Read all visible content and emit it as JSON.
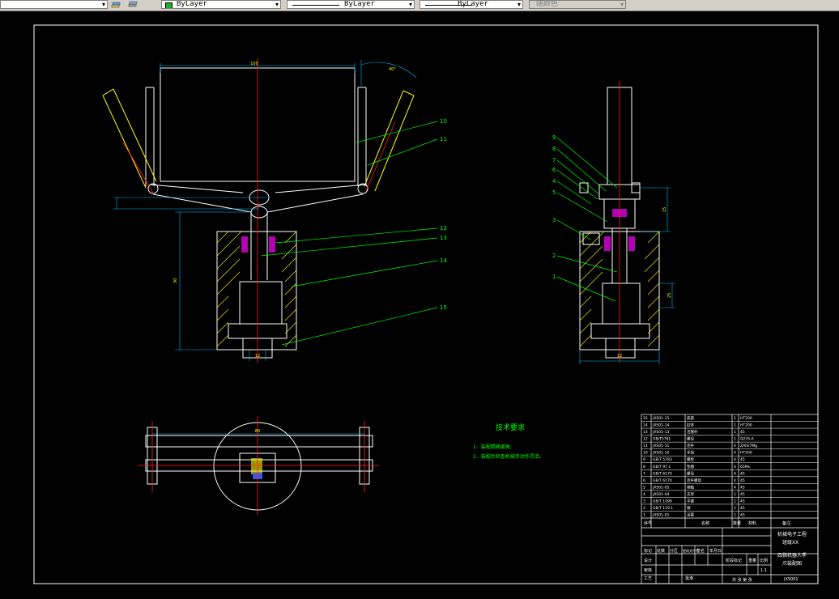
{
  "toolbar": {
    "layer_arrow": "▾",
    "color_value": "ByLayer",
    "linetype_value": "ByLayer",
    "lineweight_value": "ByLayer",
    "plotstyle_value": "随颜色",
    "icons": [
      "layers-icon",
      "layer-states-icon"
    ]
  },
  "drawing": {
    "dim_top_width": "100",
    "dim_angle": "40°",
    "dim_height": "30",
    "dim_bottom": "12",
    "dim_side_vertical": "15",
    "dim_side_lower": "25",
    "dim_side_bottom": "12",
    "dim_plan": "80",
    "part_numbers_left": [
      "10",
      "11",
      "12",
      "13",
      "14",
      "15"
    ],
    "part_numbers_right": [
      "9",
      "8",
      "7",
      "6",
      "5",
      "4",
      "3",
      "2",
      "1"
    ]
  },
  "tech_requirements": {
    "title": "技术要求",
    "item1": "1、装配精确度高;",
    "item2": "2、装配后检查机械手动作灵活。"
  },
  "title_block": {
    "company_line1": "机械电子工程",
    "company_line2": "班级XX",
    "drawing_name_line1": "四指机器人手",
    "drawing_name_line2": "爪装配图",
    "drawing_no": "JXS001",
    "scale_label": "比例",
    "scale_value": "1:1",
    "sheet_label": "共 张 第 张",
    "header_seq": "序号",
    "header_name": "名称",
    "header_qty": "数量",
    "header_material": "材料",
    "header_note": "备注",
    "rows": [
      {
        "no": "15",
        "code": "JXS01-15",
        "name": "底座",
        "qty": "1",
        "mat": "HT200"
      },
      {
        "no": "14",
        "code": "JXS01-14",
        "name": "缸体",
        "qty": "1",
        "mat": "HT200"
      },
      {
        "no": "13",
        "code": "JXS01-13",
        "name": "活塞杆",
        "qty": "1",
        "mat": "45"
      },
      {
        "no": "12",
        "code": "GB/T5781",
        "name": "螺母",
        "qty": "1",
        "mat": "Q235-A"
      },
      {
        "no": "11",
        "code": "JXS01-11",
        "name": "连杆",
        "qty": "4",
        "mat": "ZAlSi7Mg"
      },
      {
        "no": "10",
        "code": "JXS01-10",
        "name": "手指",
        "qty": "4",
        "mat": "HT200"
      },
      {
        "no": "9",
        "code": "GB/T 5783",
        "name": "螺栓",
        "qty": "4",
        "mat": "45"
      },
      {
        "no": "8",
        "code": "GB/T 97.1",
        "name": "垫圈",
        "qty": "4",
        "mat": "65Mn"
      },
      {
        "no": "7",
        "code": "GB/T 6170",
        "name": "螺母",
        "qty": "4",
        "mat": "45"
      },
      {
        "no": "6",
        "code": "GB/T 6170",
        "name": "连杆螺母",
        "qty": "4",
        "mat": "45"
      },
      {
        "no": "5",
        "code": "JXS01-05",
        "name": "销轴",
        "qty": "4",
        "mat": "45"
      },
      {
        "no": "4",
        "code": "JXS01-04",
        "name": "支架",
        "qty": "1",
        "mat": "45"
      },
      {
        "no": "3",
        "code": "GB/T 1096",
        "name": "平键",
        "qty": "1",
        "mat": "45"
      },
      {
        "no": "2",
        "code": "GB/T 119.1",
        "name": "销",
        "qty": "1",
        "mat": "45"
      },
      {
        "no": "1",
        "code": "JXS01-01",
        "name": "活塞",
        "qty": "1",
        "mat": "45"
      }
    ],
    "sign_labels": [
      "标记",
      "处数",
      "分区",
      "更改文件号",
      "签名",
      "年月日"
    ],
    "design_labels": [
      "设计",
      "审核",
      "工艺",
      "批准"
    ],
    "stage_label": "阶段标记",
    "weight_label": "重量"
  }
}
